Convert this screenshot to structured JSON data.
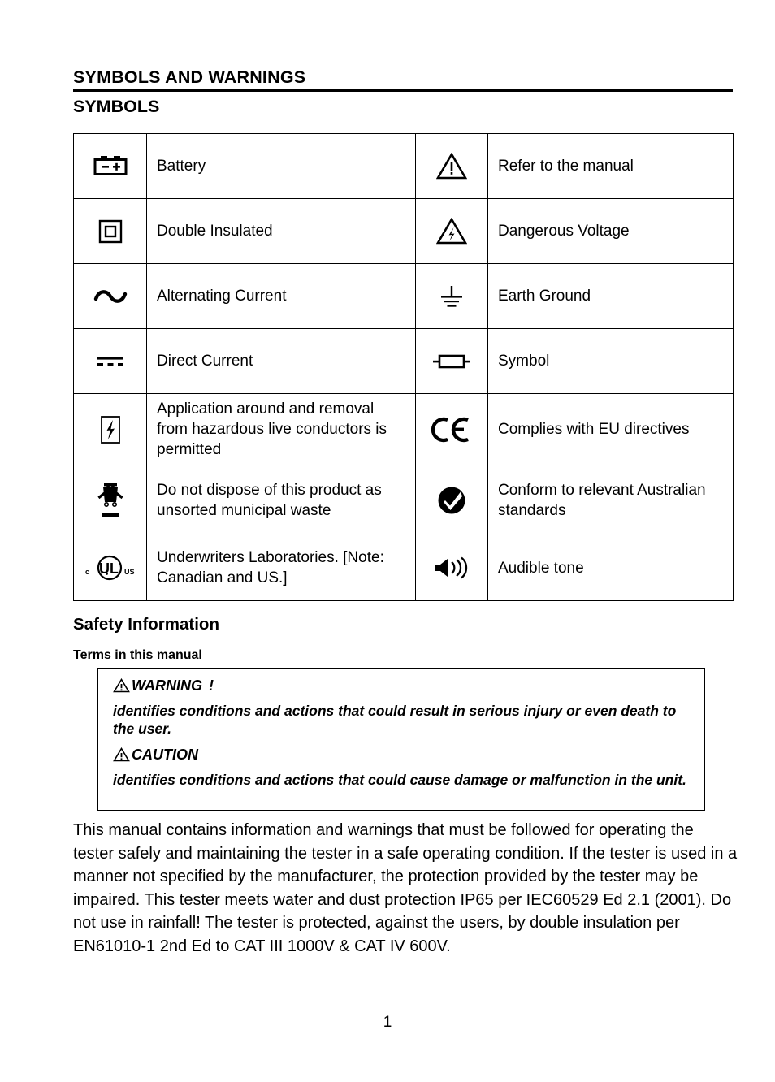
{
  "headings": {
    "chapter": "SYMBOLS AND WARNINGS",
    "section": "SYMBOLS",
    "safety": "Safety Information",
    "terms": "Terms in this manual"
  },
  "symbols_table": {
    "rows": [
      {
        "left": {
          "icon": "battery-icon",
          "label": "Battery"
        },
        "right": {
          "icon": "warning-triangle-icon",
          "label": "Refer to the manual"
        }
      },
      {
        "left": {
          "icon": "double-insulated-icon",
          "label": "Double Insulated"
        },
        "right": {
          "icon": "dangerous-voltage-icon",
          "label": "Dangerous Voltage"
        }
      },
      {
        "left": {
          "icon": "alternating-current-icon",
          "label": "Alternating Current"
        },
        "right": {
          "icon": "earth-ground-icon",
          "label": "Earth Ground"
        }
      },
      {
        "left": {
          "icon": "direct-current-icon",
          "label": "Direct Current"
        },
        "right": {
          "icon": "fuse-icon",
          "label": "Symbol"
        }
      },
      {
        "left": {
          "icon": "live-conductors-icon",
          "label": "Application around and removal from hazardous live conductors is permitted"
        },
        "right": {
          "icon": "ce-mark-icon",
          "label": "Complies with EU directives"
        }
      },
      {
        "left": {
          "icon": "weee-bin-icon",
          "label": "Do not dispose of this product as unsorted municipal waste"
        },
        "right": {
          "icon": "c-tick-icon",
          "label": "Conform to relevant Australian standards"
        }
      },
      {
        "left": {
          "icon": "ul-listed-icon",
          "label": "Underwriters Laboratories. [Note: Canadian and US.]"
        },
        "right": {
          "icon": "audible-tone-icon",
          "label": "Audible tone"
        }
      }
    ]
  },
  "warning_box": {
    "warning_title": "WARNING",
    "warning_bang": "!",
    "warning_text": "identifies conditions and actions that could result in serious injury or even death to the user.",
    "caution_title": "CAUTION",
    "caution_text": "identifies conditions and actions that could cause damage or malfunction in the unit."
  },
  "body": {
    "paragraph": "This manual contains information and warnings that must be followed for operating the tester safely and maintaining the tester in a safe operating condition. If the tester is used in a manner not specified by the manufacturer, the protection provided by the tester may be impaired. This tester meets water and dust protection IP65 per IEC60529 Ed 2.1 (2001). Do not use in rainfall! The tester is protected, against the users, by double insulation per EN61010-1 2nd Ed to CAT III 1000V & CAT IV 600V."
  },
  "footer": {
    "page_number": "1"
  },
  "colors": {
    "ink": "#000000",
    "paper": "#ffffff"
  }
}
